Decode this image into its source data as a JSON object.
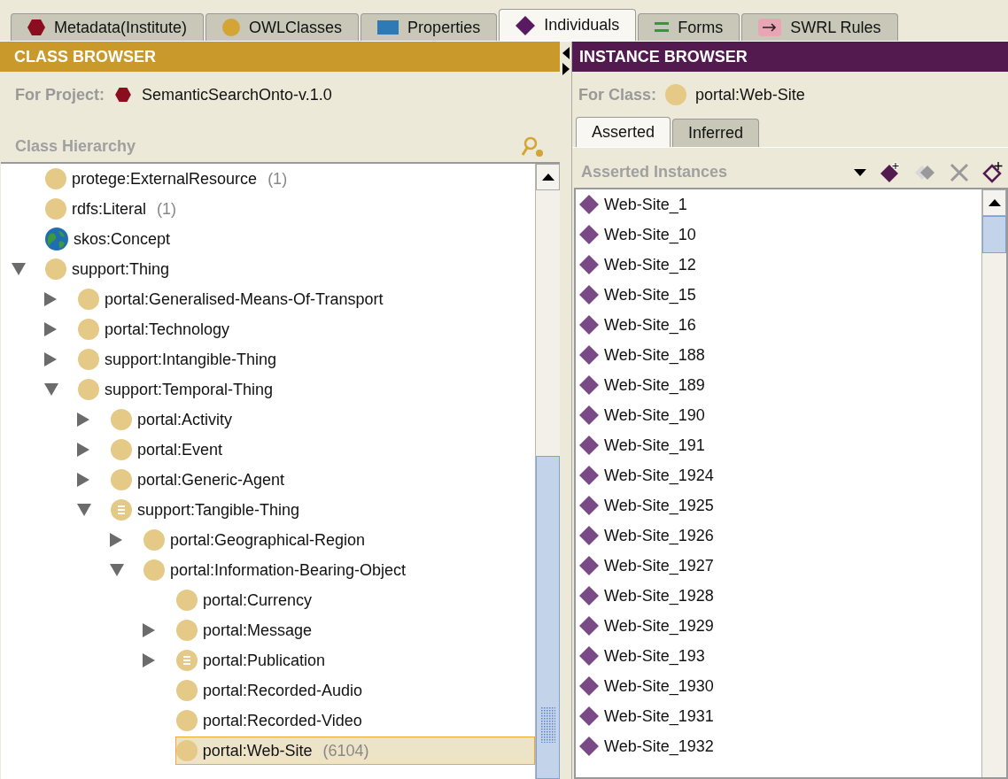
{
  "tabs": [
    {
      "label": "Metadata(Institute)",
      "kind": "hexagon",
      "selected": false
    },
    {
      "label": "OWLClasses",
      "kind": "circle",
      "selected": false
    },
    {
      "label": "Properties",
      "kind": "rect",
      "selected": false
    },
    {
      "label": "Individuals",
      "kind": "diamond",
      "selected": true
    },
    {
      "label": "Forms",
      "kind": "forms",
      "selected": false
    },
    {
      "label": "SWRL Rules",
      "kind": "rule",
      "selected": false
    }
  ],
  "class_browser": {
    "title": "CLASS BROWSER",
    "project_label": "For Project:",
    "project": "SemanticSearchOnto-v.1.0",
    "hierarchy_label": "Class Hierarchy",
    "tree": [
      {
        "label": "protege:ExternalResource",
        "count": "(1)",
        "kind": "plain",
        "selected": false
      },
      {
        "label": "rdfs:Literal",
        "count": "(1)",
        "kind": "plain",
        "selected": false
      },
      {
        "label": "skos:Concept",
        "kind": "globe",
        "selected": false
      },
      {
        "label": "support:Thing",
        "kind": "plain",
        "selected": false,
        "expanded": true,
        "children": [
          {
            "label": "portal:Generalised-Means-Of-Transport",
            "kind": "plain",
            "selected": false,
            "expanded": false
          },
          {
            "label": "portal:Technology",
            "kind": "plain",
            "selected": false,
            "expanded": false
          },
          {
            "label": "support:Intangible-Thing",
            "kind": "plain",
            "selected": false,
            "expanded": false
          },
          {
            "label": "support:Temporal-Thing",
            "kind": "plain",
            "selected": false,
            "expanded": true,
            "children": [
              {
                "label": "portal:Activity",
                "kind": "plain",
                "selected": false,
                "expanded": false
              },
              {
                "label": "portal:Event",
                "kind": "plain",
                "selected": false,
                "expanded": false
              },
              {
                "label": "portal:Generic-Agent",
                "kind": "plain",
                "selected": false,
                "expanded": false
              },
              {
                "label": "support:Tangible-Thing",
                "kind": "list",
                "selected": false,
                "expanded": true,
                "children": [
                  {
                    "label": "portal:Geographical-Region",
                    "kind": "plain",
                    "selected": false,
                    "expanded": false
                  },
                  {
                    "label": "portal:Information-Bearing-Object",
                    "kind": "plain",
                    "selected": false,
                    "expanded": true,
                    "children": [
                      {
                        "label": "portal:Currency",
                        "kind": "plain",
                        "selected": false
                      },
                      {
                        "label": "portal:Message",
                        "kind": "plain",
                        "selected": false,
                        "expanded": false
                      },
                      {
                        "label": "portal:Publication",
                        "kind": "list",
                        "selected": false,
                        "expanded": false
                      },
                      {
                        "label": "portal:Recorded-Audio",
                        "kind": "plain",
                        "selected": false
                      },
                      {
                        "label": "portal:Recorded-Video",
                        "kind": "plain",
                        "selected": false
                      },
                      {
                        "label": "portal:Web-Site",
                        "count": "(6104)",
                        "kind": "plain",
                        "selected": true
                      }
                    ]
                  }
                ]
              }
            ]
          }
        ]
      }
    ]
  },
  "instance_browser": {
    "title": "INSTANCE BROWSER",
    "class_label": "For Class:",
    "class": "portal:Web-Site",
    "tabs": [
      {
        "label": "Asserted",
        "selected": true
      },
      {
        "label": "Inferred",
        "selected": false
      }
    ],
    "instances_label": "Asserted Instances",
    "instances": [
      "Web-Site_1",
      "Web-Site_10",
      "Web-Site_12",
      "Web-Site_15",
      "Web-Site_16",
      "Web-Site_188",
      "Web-Site_189",
      "Web-Site_190",
      "Web-Site_191",
      "Web-Site_1924",
      "Web-Site_1925",
      "Web-Site_1926",
      "Web-Site_1927",
      "Web-Site_1928",
      "Web-Site_1929",
      "Web-Site_193",
      "Web-Site_1930",
      "Web-Site_1931",
      "Web-Site_1932"
    ]
  }
}
